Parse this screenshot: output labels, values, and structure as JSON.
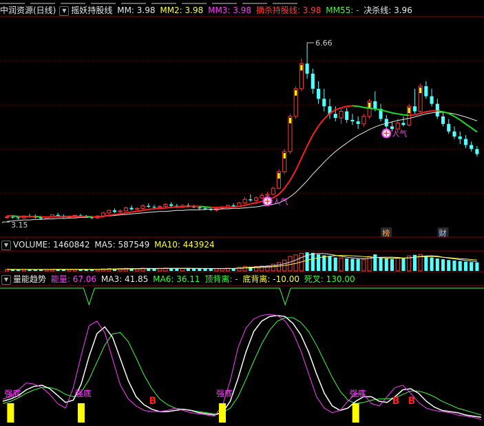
{
  "main_header": {
    "stock": "中润资源(日线)",
    "indicator": "摇妖持股线",
    "mm": "MM: 3.98",
    "mm2": "MM2: 3.98",
    "mm3": "MM3: 3.98",
    "chi": "摘杀持股线: 3.98",
    "mm55": "MM55: -",
    "jue": "决杀线: 3.96"
  },
  "volume_header": {
    "volume": "VOLUME: 1460842",
    "ma5": "MA5: 587549",
    "ma10": "MA10: 443924"
  },
  "energy_header": {
    "title": "量能趋势",
    "energy": "能量: 67.06",
    "ma3": "MA3: 41.85",
    "ma6": "MA6: 36.11",
    "top_div": "顶背离: -",
    "bot_div": "底背离: -10.00",
    "death_cross": "死叉: 130.00"
  },
  "colors": {
    "up": "#ff3c3c",
    "down": "#54ffff",
    "ma_red": "#ff2020",
    "ma_green": "#20e020",
    "ma_white": "#e8e8e8",
    "energy": "#ff3cff",
    "ma3": "#ffffff",
    "ma6": "#3cff3c",
    "bar": "#ffff00",
    "grid": "#8b0000"
  },
  "chart_data": [
    {
      "type": "candlestick",
      "title": "摇妖持股线",
      "price_min": 3.15,
      "price_max": 6.66,
      "max_label": "6.66",
      "min_label": "3.15",
      "candles": [
        [
          3.24,
          3.28,
          3.21,
          3.25
        ],
        [
          3.25,
          3.29,
          3.22,
          3.24
        ],
        [
          3.24,
          3.27,
          3.2,
          3.23
        ],
        [
          3.23,
          3.28,
          3.22,
          3.27
        ],
        [
          3.27,
          3.31,
          3.24,
          3.26
        ],
        [
          3.26,
          3.3,
          3.22,
          3.24
        ],
        [
          3.24,
          3.27,
          3.2,
          3.22
        ],
        [
          3.22,
          3.26,
          3.2,
          3.25
        ],
        [
          3.25,
          3.3,
          3.23,
          3.29
        ],
        [
          3.29,
          3.33,
          3.26,
          3.27
        ],
        [
          3.27,
          3.3,
          3.23,
          3.25
        ],
        [
          3.25,
          3.28,
          3.22,
          3.26
        ],
        [
          3.26,
          3.29,
          3.24,
          3.28
        ],
        [
          3.28,
          3.31,
          3.25,
          3.26
        ],
        [
          3.26,
          3.29,
          3.23,
          3.24
        ],
        [
          3.24,
          3.27,
          3.21,
          3.23
        ],
        [
          3.23,
          3.28,
          3.22,
          3.27
        ],
        [
          3.27,
          3.35,
          3.25,
          3.33
        ],
        [
          3.33,
          3.4,
          3.3,
          3.38
        ],
        [
          3.38,
          3.42,
          3.33,
          3.35
        ],
        [
          3.35,
          3.4,
          3.32,
          3.37
        ],
        [
          3.37,
          3.45,
          3.35,
          3.43
        ],
        [
          3.43,
          3.48,
          3.38,
          3.4
        ],
        [
          3.4,
          3.44,
          3.36,
          3.42
        ],
        [
          3.42,
          3.5,
          3.4,
          3.47
        ],
        [
          3.47,
          3.52,
          3.43,
          3.45
        ],
        [
          3.45,
          3.49,
          3.41,
          3.44
        ],
        [
          3.44,
          3.48,
          3.4,
          3.46
        ],
        [
          3.46,
          3.52,
          3.44,
          3.5
        ],
        [
          3.5,
          3.54,
          3.45,
          3.47
        ],
        [
          3.47,
          3.51,
          3.43,
          3.45
        ],
        [
          3.45,
          3.5,
          3.42,
          3.48
        ],
        [
          3.48,
          3.52,
          3.44,
          3.46
        ],
        [
          3.46,
          3.49,
          3.42,
          3.44
        ],
        [
          3.44,
          3.47,
          3.4,
          3.42
        ],
        [
          3.42,
          3.46,
          3.38,
          3.41
        ],
        [
          3.41,
          3.44,
          3.37,
          3.39
        ],
        [
          3.39,
          3.43,
          3.36,
          3.42
        ],
        [
          3.42,
          3.47,
          3.4,
          3.45
        ],
        [
          3.45,
          3.5,
          3.43,
          3.48
        ],
        [
          3.48,
          3.52,
          3.44,
          3.46
        ],
        [
          3.46,
          3.55,
          3.45,
          3.53
        ],
        [
          3.53,
          3.65,
          3.5,
          3.6
        ],
        [
          3.6,
          3.7,
          3.55,
          3.58
        ],
        [
          3.58,
          3.66,
          3.54,
          3.63
        ],
        [
          3.63,
          3.72,
          3.6,
          3.68
        ],
        [
          3.68,
          3.75,
          3.64,
          3.7
        ],
        [
          3.7,
          3.85,
          3.68,
          3.82
        ],
        [
          3.82,
          4.2,
          3.8,
          4.15
        ],
        [
          4.15,
          4.6,
          4.1,
          4.55
        ],
        [
          4.55,
          5.3,
          4.5,
          5.25
        ],
        [
          5.25,
          5.85,
          5.2,
          5.8
        ],
        [
          5.8,
          6.4,
          5.75,
          6.3
        ],
        [
          6.3,
          6.66,
          6.0,
          6.1
        ],
        [
          6.1,
          6.2,
          5.7,
          5.8
        ],
        [
          5.8,
          5.95,
          5.5,
          5.6
        ],
        [
          5.6,
          5.8,
          5.35,
          5.45
        ],
        [
          5.45,
          5.6,
          5.2,
          5.3
        ],
        [
          5.3,
          5.45,
          5.15,
          5.22
        ],
        [
          5.22,
          5.4,
          5.1,
          5.35
        ],
        [
          5.35,
          5.42,
          5.12,
          5.18
        ],
        [
          5.18,
          5.3,
          5.08,
          5.15
        ],
        [
          5.15,
          5.25,
          5.0,
          5.1
        ],
        [
          5.1,
          5.3,
          5.05,
          5.25
        ],
        [
          5.25,
          5.6,
          5.2,
          5.55
        ],
        [
          5.55,
          5.75,
          5.35,
          5.4
        ],
        [
          5.4,
          5.5,
          5.15,
          5.2
        ],
        [
          5.2,
          5.28,
          5.0,
          5.05
        ],
        [
          5.05,
          5.15,
          4.95,
          5.0
        ],
        [
          5.0,
          5.2,
          4.92,
          5.12
        ],
        [
          5.12,
          5.25,
          5.05,
          5.08
        ],
        [
          5.08,
          5.5,
          5.05,
          5.45
        ],
        [
          5.45,
          5.8,
          5.3,
          5.35
        ],
        [
          5.35,
          5.9,
          5.3,
          5.85
        ],
        [
          5.85,
          5.95,
          5.6,
          5.65
        ],
        [
          5.65,
          5.8,
          5.45,
          5.5
        ],
        [
          5.5,
          5.6,
          5.2,
          5.25
        ],
        [
          5.25,
          5.35,
          5.05,
          5.1
        ],
        [
          5.1,
          5.2,
          4.9,
          4.95
        ],
        [
          4.95,
          5.05,
          4.8,
          4.85
        ],
        [
          4.85,
          4.95,
          4.7,
          4.8
        ],
        [
          4.8,
          4.88,
          4.62,
          4.68
        ],
        [
          4.68,
          4.75,
          4.55,
          4.6
        ],
        [
          4.6,
          4.66,
          4.45,
          4.5
        ]
      ],
      "ma_red_green": [
        3.27,
        3.27,
        3.26,
        3.26,
        3.26,
        3.26,
        3.25,
        3.25,
        3.25,
        3.26,
        3.26,
        3.26,
        3.26,
        3.26,
        3.26,
        3.25,
        3.25,
        3.26,
        3.28,
        3.3,
        3.31,
        3.33,
        3.35,
        3.36,
        3.38,
        3.4,
        3.41,
        3.42,
        3.43,
        3.44,
        3.45,
        3.45,
        3.46,
        3.46,
        3.46,
        3.45,
        3.44,
        3.44,
        3.44,
        3.44,
        3.45,
        3.46,
        3.48,
        3.51,
        3.53,
        3.56,
        3.59,
        3.63,
        3.7,
        3.82,
        3.98,
        4.18,
        4.42,
        4.66,
        4.88,
        5.06,
        5.2,
        5.31,
        5.38,
        5.42,
        5.45,
        5.46,
        5.45,
        5.43,
        5.41,
        5.4,
        5.38,
        5.35,
        5.32,
        5.3,
        5.28,
        5.27,
        5.28,
        5.31,
        5.34,
        5.36,
        5.36,
        5.34,
        5.31,
        5.25,
        5.18,
        5.1,
        5.02,
        4.94
      ],
      "ma_white": [
        3.16,
        3.17,
        3.18,
        3.19,
        3.19,
        3.2,
        3.2,
        3.21,
        3.21,
        3.22,
        3.22,
        3.23,
        3.23,
        3.24,
        3.24,
        3.25,
        3.25,
        3.26,
        3.27,
        3.28,
        3.29,
        3.3,
        3.31,
        3.32,
        3.33,
        3.34,
        3.35,
        3.36,
        3.36,
        3.37,
        3.38,
        3.38,
        3.39,
        3.39,
        3.39,
        3.4,
        3.4,
        3.4,
        3.41,
        3.41,
        3.42,
        3.42,
        3.43,
        3.44,
        3.45,
        3.47,
        3.48,
        3.5,
        3.53,
        3.58,
        3.65,
        3.74,
        3.85,
        3.97,
        4.1,
        4.22,
        4.34,
        4.45,
        4.55,
        4.64,
        4.72,
        4.8,
        4.87,
        4.93,
        4.99,
        5.04,
        5.08,
        5.11,
        5.14,
        5.17,
        5.19,
        5.21,
        5.24,
        5.27,
        5.3,
        5.32,
        5.33,
        5.33,
        5.32,
        5.3,
        5.27,
        5.24,
        5.2,
        5.16
      ],
      "markers": [
        {
          "index": 46,
          "text": "人气"
        },
        {
          "index": 67,
          "text": "人气"
        }
      ],
      "bottom_labels": [
        {
          "index": 67,
          "text": "榜"
        },
        {
          "index": 77,
          "text": "财"
        }
      ]
    },
    {
      "type": "bar",
      "title": "VOLUME",
      "values": [
        60,
        55,
        50,
        58,
        62,
        57,
        52,
        50,
        60,
        65,
        58,
        55,
        60,
        62,
        55,
        52,
        58,
        80,
        95,
        85,
        90,
        100,
        92,
        88,
        105,
        98,
        90,
        94,
        110,
        100,
        96,
        102,
        98,
        92,
        88,
        86,
        84,
        90,
        96,
        104,
        100,
        140,
        180,
        160,
        170,
        190,
        200,
        260,
        320,
        420,
        560,
        620,
        680,
        720,
        700,
        640,
        600,
        560,
        520,
        500,
        480,
        470,
        460,
        450,
        560,
        640,
        520,
        480,
        460,
        500,
        480,
        580,
        620,
        640,
        560,
        520,
        480,
        450,
        420,
        400,
        380,
        360,
        340,
        330
      ],
      "ma5": [
        58,
        57,
        56,
        57,
        57,
        56,
        56,
        56,
        57,
        59,
        59,
        58,
        59,
        60,
        58,
        57,
        57,
        63,
        70,
        76,
        81,
        90,
        92,
        92,
        95,
        96,
        95,
        97,
        100,
        98,
        98,
        100,
        100,
        97,
        95,
        92,
        90,
        90,
        90,
        92,
        95,
        106,
        126,
        141,
        156,
        170,
        180,
        196,
        228,
        278,
        340,
        420,
        520,
        600,
        652,
        672,
        668,
        644,
        604,
        564,
        532,
        506,
        486,
        472,
        484,
        520,
        526,
        530,
        532,
        520,
        498,
        500,
        528,
        564,
        580,
        584,
        572,
        532,
        494,
        466,
        438,
        408,
        382,
        360
      ],
      "ma10": [
        58,
        58,
        57,
        57,
        57,
        57,
        57,
        56,
        57,
        58,
        58,
        58,
        58,
        59,
        58,
        58,
        58,
        60,
        64,
        67,
        70,
        75,
        78,
        80,
        85,
        88,
        89,
        91,
        95,
        96,
        96,
        97,
        99,
        97,
        96,
        95,
        94,
        93,
        94,
        95,
        95,
        101,
        111,
        119,
        127,
        137,
        147,
        163,
        184,
        210,
        245,
        290,
        350,
        410,
        465,
        510,
        545,
        572,
        588,
        596,
        592,
        584,
        570,
        553,
        538,
        524,
        510,
        498,
        493,
        493,
        497,
        510,
        527,
        548,
        558,
        560,
        548,
        528,
        509,
        492,
        475,
        458,
        440,
        420
      ]
    },
    {
      "type": "line",
      "title": "量能趋势",
      "ylim": [
        0,
        100
      ],
      "energy": [
        20,
        22,
        28,
        34,
        33,
        30,
        24,
        16,
        12,
        30,
        58,
        84,
        88,
        78,
        55,
        32,
        20,
        14,
        10,
        9,
        9,
        10,
        12,
        10,
        8,
        7,
        6,
        5,
        14,
        36,
        65,
        82,
        90,
        93,
        94,
        93,
        88,
        78,
        62,
        42,
        22,
        12,
        8,
        10,
        18,
        25,
        24,
        16,
        14,
        22,
        30,
        32,
        25,
        17,
        12,
        10,
        9,
        8,
        6,
        5,
        4,
        2
      ],
      "ma3": [
        18,
        20,
        23,
        28,
        31,
        32,
        29,
        23,
        17,
        19,
        33,
        57,
        77,
        83,
        74,
        55,
        36,
        22,
        15,
        11,
        9,
        9,
        10,
        11,
        10,
        8,
        7,
        6,
        8,
        18,
        38,
        61,
        79,
        88,
        92,
        93,
        92,
        86,
        76,
        61,
        42,
        25,
        14,
        10,
        12,
        18,
        22,
        22,
        18,
        17,
        22,
        28,
        29,
        25,
        18,
        13,
        10,
        9,
        8,
        6,
        5,
        4
      ],
      "ma6": [
        16,
        18,
        21,
        25,
        28,
        30,
        30,
        28,
        24,
        22,
        26,
        37,
        52,
        67,
        77,
        78,
        70,
        56,
        41,
        29,
        20,
        15,
        12,
        11,
        10,
        9,
        8,
        7,
        8,
        12,
        22,
        37,
        53,
        68,
        80,
        88,
        91,
        91,
        87,
        79,
        67,
        53,
        39,
        27,
        19,
        16,
        17,
        19,
        20,
        20,
        21,
        24,
        27,
        27,
        25,
        22,
        18,
        15,
        12,
        10,
        8,
        6
      ],
      "signal_line": [
        {
          "index": 11,
          "value": "down"
        },
        {
          "index": 36,
          "value": "down"
        }
      ],
      "signals": [
        {
          "index": 1,
          "label": "强底",
          "bar": true
        },
        {
          "index": 10,
          "label": "强底",
          "bar": true
        },
        {
          "index": 19,
          "label": "B",
          "bar": false
        },
        {
          "index": 28,
          "label": "强底",
          "bar": true
        },
        {
          "index": 45,
          "label": "强底",
          "bar": true
        },
        {
          "index": 50,
          "label": "B",
          "bar": false
        },
        {
          "index": 52,
          "label": "B",
          "bar": false
        }
      ]
    }
  ]
}
